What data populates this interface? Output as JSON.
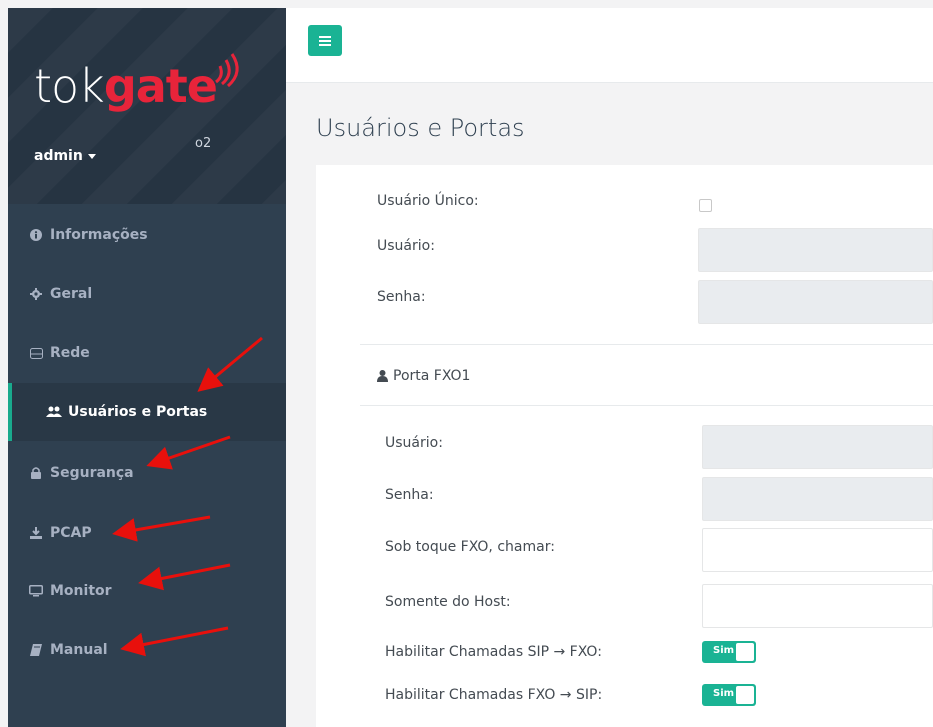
{
  "brand": {
    "tok": "tok",
    "gate": "gate",
    "sub": "o2"
  },
  "user": {
    "name": "admin"
  },
  "nav": [
    {
      "label": "Informações",
      "icon": "info-circle-icon",
      "glyph": "❶"
    },
    {
      "label": "Geral",
      "icon": "gear-icon",
      "glyph": "✱"
    },
    {
      "label": "Rede",
      "icon": "network-icon",
      "glyph": "⊟"
    },
    {
      "label": "Usuários e Portas",
      "icon": "users-icon",
      "glyph": "👥",
      "active": true
    },
    {
      "label": "Segurança",
      "icon": "lock-icon",
      "glyph": "🔒"
    },
    {
      "label": "PCAP",
      "icon": "download-icon",
      "glyph": "⭳"
    },
    {
      "label": "Monitor",
      "icon": "monitor-icon",
      "glyph": "🖵"
    },
    {
      "label": "Manual",
      "icon": "book-icon",
      "glyph": "📖"
    }
  ],
  "page": {
    "title": "Usuários e Portas"
  },
  "form": {
    "single_user_label": "Usuário Único:",
    "user_label": "Usuário:",
    "password_label": "Senha:",
    "port_section": "Porta FXO1",
    "port_user_label": "Usuário:",
    "port_password_label": "Senha:",
    "ring_call_label": "Sob toque FXO, chamar:",
    "host_only_label": "Somente do Host:",
    "enable_sip_fxo_label": "Habilitar Chamadas SIP → FXO:",
    "enable_fxo_sip_label": "Habilitar Chamadas FXO → SIP:",
    "switch_on_text": "Sim"
  },
  "colors": {
    "accent": "#1ab394",
    "sidebar": "#2f4050",
    "brand_red": "#e8243a",
    "arrow": "#e8100c"
  }
}
